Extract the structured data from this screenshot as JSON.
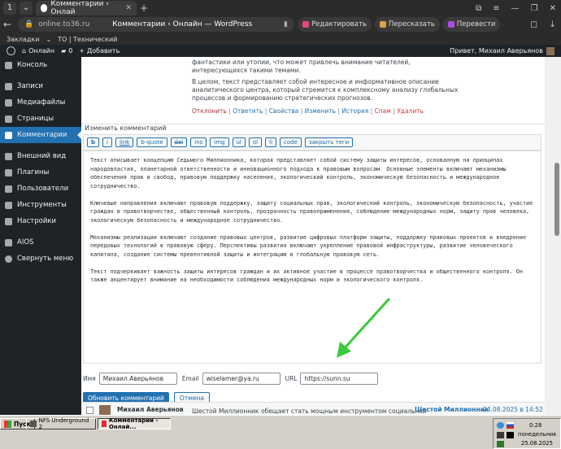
{
  "browser": {
    "tab_title": "Комментарии ‹ Онлай",
    "url_host": "online.to36.ru",
    "page_title": "Комментарии ‹ Онлайн — WordPress",
    "ext_buttons": [
      "Редактировать",
      "Пересказать",
      "Перевести"
    ],
    "bookmarks_label": "Закладки",
    "bookmark_item": "ТО | Технический"
  },
  "adminbar": {
    "site_name": "Онлайн",
    "comments_count": "0",
    "add_label": "Добавить",
    "greeting": "Привет, Михаил Аверьянов"
  },
  "sidebar": {
    "items": [
      {
        "label": "Консоль"
      },
      {
        "label": "Записи"
      },
      {
        "label": "Медиафайлы"
      },
      {
        "label": "Страницы"
      },
      {
        "label": "Комментарии"
      },
      {
        "label": "Внешний вид"
      },
      {
        "label": "Плагины"
      },
      {
        "label": "Пользователи"
      },
      {
        "label": "Инструменты"
      },
      {
        "label": "Настройки"
      },
      {
        "label": "AIOS"
      },
      {
        "label": "Свернуть меню"
      }
    ]
  },
  "preview": {
    "line1": "фантастики или утопии, что может привлечь внимание читателей,",
    "line2": "интересующихся такими темами.",
    "line3": "В целом, текст представляет собой интересное и информативное описание",
    "line4": "аналитического центра, который стремится к комплексному анализу глобальных",
    "line5": "процессов и формированию стратегических прогнозов.",
    "actions": [
      "Отклонить",
      "Ответить",
      "Свойства",
      "Изменить",
      "История",
      "Спам",
      "Удалить"
    ]
  },
  "edit": {
    "title": "Изменить комментарий",
    "toolbar": [
      "b",
      "i",
      "link",
      "b-quote",
      "del",
      "ins",
      "img",
      "ul",
      "ol",
      "li",
      "code",
      "закрыть теги"
    ],
    "paragraphs": [
      "Текст описывает концепцию Седьмого Миллионника, которая представляет собой систему защиты интересов, основанную на принципах народовластия, планетарной ответственности и инновационного подхода к правовым вопросам. Основные элементы включают механизмы обеспечения прав и свобод, правовую поддержку населения, экологический контроль, экономическую безопасность и международное сотрудничество.",
      "Ключевые направления включают правовую поддержку, защиту социальных прав, экологический контроль, экономическую безопасность, участие граждан в правотворчестве, общественный контроль, прозрачность правоприменения, соблюдение международных норм, защиту прав человека, экологическую безопасность и международное сотрудничество.",
      "Механизмы реализации включают создание правовых центров, развитие цифровых платформ защиты, поддержку правовых проектов и внедрение передовых технологий в правовую сферу. Перспективы развития включают укрепление правовой инфраструктуры, развитие человеческого капитала, создание системы превентивной защиты и интеграцию в глобальную правовую сеть.",
      "Текст подчеркивает важность защиты интересов граждан и их активное участие в процессе правотворчества и общественного контроля. Он также акцентирует внимание на необходимости соблюдения международных норм и экологического контроля."
    ],
    "name_label": "Имя",
    "name_value": "Михаил Аверьянов",
    "email_label": "Email",
    "email_value": "wiselamer@ya.ru",
    "url_label": "URL",
    "url_value": "https://sunn.su",
    "update_btn": "Обновить комментарий",
    "cancel_btn": "Отмена"
  },
  "next_comment": {
    "author": "Михаил Аверьянов",
    "text": "Шестой Миллионник обещает стать мощным инструментом социальной",
    "post": "Шестой Миллионник",
    "date": "24.08.2025 в 14:52"
  },
  "taskbar": {
    "start": "Пуск",
    "tasks": [
      "Desktop",
      "NFS Underground 2",
      "Комментарии ‹ Онлай..."
    ],
    "time": "0:28",
    "day": "понедельник",
    "date": "25.08.2025"
  },
  "colors": {
    "wp_blue": "#2271b1",
    "admin_dark": "#1d2327",
    "arrow_green": "#3cc93c"
  }
}
